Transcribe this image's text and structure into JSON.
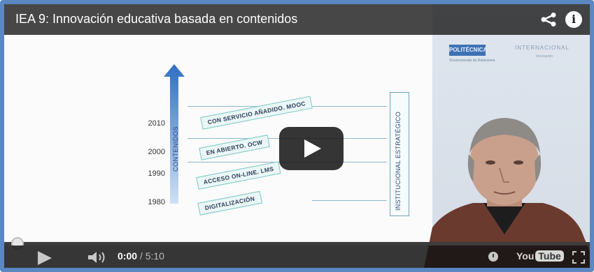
{
  "video": {
    "title": "IEA 9: Innovación educativa basada en contenidos"
  },
  "slide": {
    "axis_label": "CONTENIDOS",
    "right_label": "INSTITUCIONAL ESTRATÉGICO",
    "years": [
      "2010",
      "2000",
      "1990",
      "1980"
    ],
    "banners": [
      "CON SERVICIO AÑADIDO. MOOC",
      "EN ABIERTO. OCW",
      "ACCESO ON-LINE. LMS",
      "DIGITALIZACIÓN"
    ]
  },
  "logos": {
    "left": "POLITÉCNICA",
    "left_sub": "Vicerrectorado de Relaciones",
    "right": "INTERNACIONAL",
    "right_sub": "Innovación"
  },
  "player": {
    "current_time": "0:00",
    "separator": " / ",
    "duration": "5:10",
    "progress_fraction": 0.0,
    "youtube_you": "You",
    "youtube_tube": "Tube"
  },
  "colors": {
    "frame_border": "#5b87c2",
    "arrow": "#3b78c9",
    "banner_border": "#7cc9c6"
  }
}
